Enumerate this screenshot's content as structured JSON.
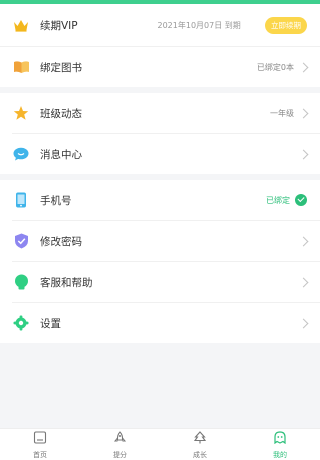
{
  "colors": {
    "accent": "#2cbf7a",
    "vip_button": "#fbd64b"
  },
  "vip": {
    "label": "续期VIP",
    "expiry": "2021年10月07日 到期",
    "button": "立即续期",
    "icon": "crown-icon"
  },
  "menu": {
    "bind_book": {
      "label": "绑定图书",
      "value": "已绑定0本",
      "icon": "book-icon"
    },
    "class_news": {
      "label": "班级动态",
      "value": "一年级",
      "icon": "star-icon"
    },
    "messages": {
      "label": "消息中心",
      "icon": "chat-icon"
    },
    "phone": {
      "label": "手机号",
      "value": "已绑定",
      "icon": "phone-icon"
    },
    "password": {
      "label": "修改密码",
      "icon": "shield-icon"
    },
    "help": {
      "label": "客服和帮助",
      "icon": "headset-icon"
    },
    "settings": {
      "label": "设置",
      "icon": "gear-icon"
    }
  },
  "tabbar": [
    {
      "label": "首页",
      "icon": "home-icon"
    },
    {
      "label": "提分",
      "icon": "rocket-icon"
    },
    {
      "label": "成长",
      "icon": "tree-icon"
    },
    {
      "label": "我的",
      "icon": "user-icon",
      "active": true
    }
  ]
}
